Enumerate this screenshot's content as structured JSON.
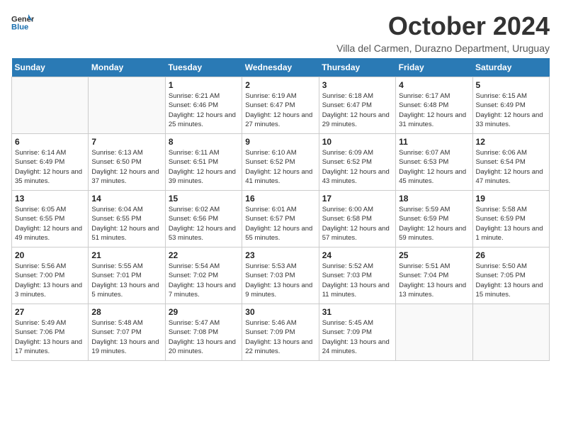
{
  "header": {
    "logo_general": "General",
    "logo_blue": "Blue",
    "month_title": "October 2024",
    "location": "Villa del Carmen, Durazno Department, Uruguay"
  },
  "days_of_week": [
    "Sunday",
    "Monday",
    "Tuesday",
    "Wednesday",
    "Thursday",
    "Friday",
    "Saturday"
  ],
  "weeks": [
    [
      {
        "day": "",
        "info": ""
      },
      {
        "day": "",
        "info": ""
      },
      {
        "day": "1",
        "info": "Sunrise: 6:21 AM\nSunset: 6:46 PM\nDaylight: 12 hours and 25 minutes."
      },
      {
        "day": "2",
        "info": "Sunrise: 6:19 AM\nSunset: 6:47 PM\nDaylight: 12 hours and 27 minutes."
      },
      {
        "day": "3",
        "info": "Sunrise: 6:18 AM\nSunset: 6:47 PM\nDaylight: 12 hours and 29 minutes."
      },
      {
        "day": "4",
        "info": "Sunrise: 6:17 AM\nSunset: 6:48 PM\nDaylight: 12 hours and 31 minutes."
      },
      {
        "day": "5",
        "info": "Sunrise: 6:15 AM\nSunset: 6:49 PM\nDaylight: 12 hours and 33 minutes."
      }
    ],
    [
      {
        "day": "6",
        "info": "Sunrise: 6:14 AM\nSunset: 6:49 PM\nDaylight: 12 hours and 35 minutes."
      },
      {
        "day": "7",
        "info": "Sunrise: 6:13 AM\nSunset: 6:50 PM\nDaylight: 12 hours and 37 minutes."
      },
      {
        "day": "8",
        "info": "Sunrise: 6:11 AM\nSunset: 6:51 PM\nDaylight: 12 hours and 39 minutes."
      },
      {
        "day": "9",
        "info": "Sunrise: 6:10 AM\nSunset: 6:52 PM\nDaylight: 12 hours and 41 minutes."
      },
      {
        "day": "10",
        "info": "Sunrise: 6:09 AM\nSunset: 6:52 PM\nDaylight: 12 hours and 43 minutes."
      },
      {
        "day": "11",
        "info": "Sunrise: 6:07 AM\nSunset: 6:53 PM\nDaylight: 12 hours and 45 minutes."
      },
      {
        "day": "12",
        "info": "Sunrise: 6:06 AM\nSunset: 6:54 PM\nDaylight: 12 hours and 47 minutes."
      }
    ],
    [
      {
        "day": "13",
        "info": "Sunrise: 6:05 AM\nSunset: 6:55 PM\nDaylight: 12 hours and 49 minutes."
      },
      {
        "day": "14",
        "info": "Sunrise: 6:04 AM\nSunset: 6:55 PM\nDaylight: 12 hours and 51 minutes."
      },
      {
        "day": "15",
        "info": "Sunrise: 6:02 AM\nSunset: 6:56 PM\nDaylight: 12 hours and 53 minutes."
      },
      {
        "day": "16",
        "info": "Sunrise: 6:01 AM\nSunset: 6:57 PM\nDaylight: 12 hours and 55 minutes."
      },
      {
        "day": "17",
        "info": "Sunrise: 6:00 AM\nSunset: 6:58 PM\nDaylight: 12 hours and 57 minutes."
      },
      {
        "day": "18",
        "info": "Sunrise: 5:59 AM\nSunset: 6:59 PM\nDaylight: 12 hours and 59 minutes."
      },
      {
        "day": "19",
        "info": "Sunrise: 5:58 AM\nSunset: 6:59 PM\nDaylight: 13 hours and 1 minute."
      }
    ],
    [
      {
        "day": "20",
        "info": "Sunrise: 5:56 AM\nSunset: 7:00 PM\nDaylight: 13 hours and 3 minutes."
      },
      {
        "day": "21",
        "info": "Sunrise: 5:55 AM\nSunset: 7:01 PM\nDaylight: 13 hours and 5 minutes."
      },
      {
        "day": "22",
        "info": "Sunrise: 5:54 AM\nSunset: 7:02 PM\nDaylight: 13 hours and 7 minutes."
      },
      {
        "day": "23",
        "info": "Sunrise: 5:53 AM\nSunset: 7:03 PM\nDaylight: 13 hours and 9 minutes."
      },
      {
        "day": "24",
        "info": "Sunrise: 5:52 AM\nSunset: 7:03 PM\nDaylight: 13 hours and 11 minutes."
      },
      {
        "day": "25",
        "info": "Sunrise: 5:51 AM\nSunset: 7:04 PM\nDaylight: 13 hours and 13 minutes."
      },
      {
        "day": "26",
        "info": "Sunrise: 5:50 AM\nSunset: 7:05 PM\nDaylight: 13 hours and 15 minutes."
      }
    ],
    [
      {
        "day": "27",
        "info": "Sunrise: 5:49 AM\nSunset: 7:06 PM\nDaylight: 13 hours and 17 minutes."
      },
      {
        "day": "28",
        "info": "Sunrise: 5:48 AM\nSunset: 7:07 PM\nDaylight: 13 hours and 19 minutes."
      },
      {
        "day": "29",
        "info": "Sunrise: 5:47 AM\nSunset: 7:08 PM\nDaylight: 13 hours and 20 minutes."
      },
      {
        "day": "30",
        "info": "Sunrise: 5:46 AM\nSunset: 7:09 PM\nDaylight: 13 hours and 22 minutes."
      },
      {
        "day": "31",
        "info": "Sunrise: 5:45 AM\nSunset: 7:09 PM\nDaylight: 13 hours and 24 minutes."
      },
      {
        "day": "",
        "info": ""
      },
      {
        "day": "",
        "info": ""
      }
    ]
  ]
}
